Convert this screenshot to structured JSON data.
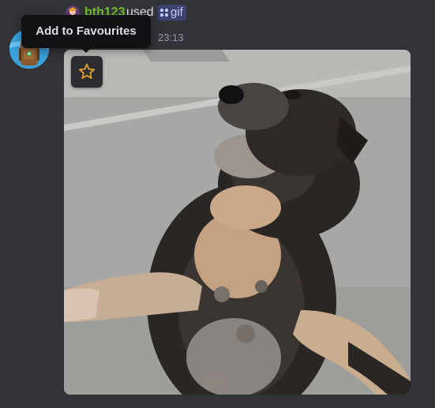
{
  "message": {
    "username": "bth123",
    "action_text": "used",
    "command_name": "gif",
    "timestamp": "23:13"
  },
  "tooltip": {
    "label": "Add to Favourites"
  },
  "gif": {
    "favourite_icon": "star-outline-icon"
  },
  "colors": {
    "background": "#313338",
    "username": "#6fbf2a",
    "command_chip": "#3c4270",
    "tooltip_bg": "#111214",
    "star": "#e0a02f"
  }
}
